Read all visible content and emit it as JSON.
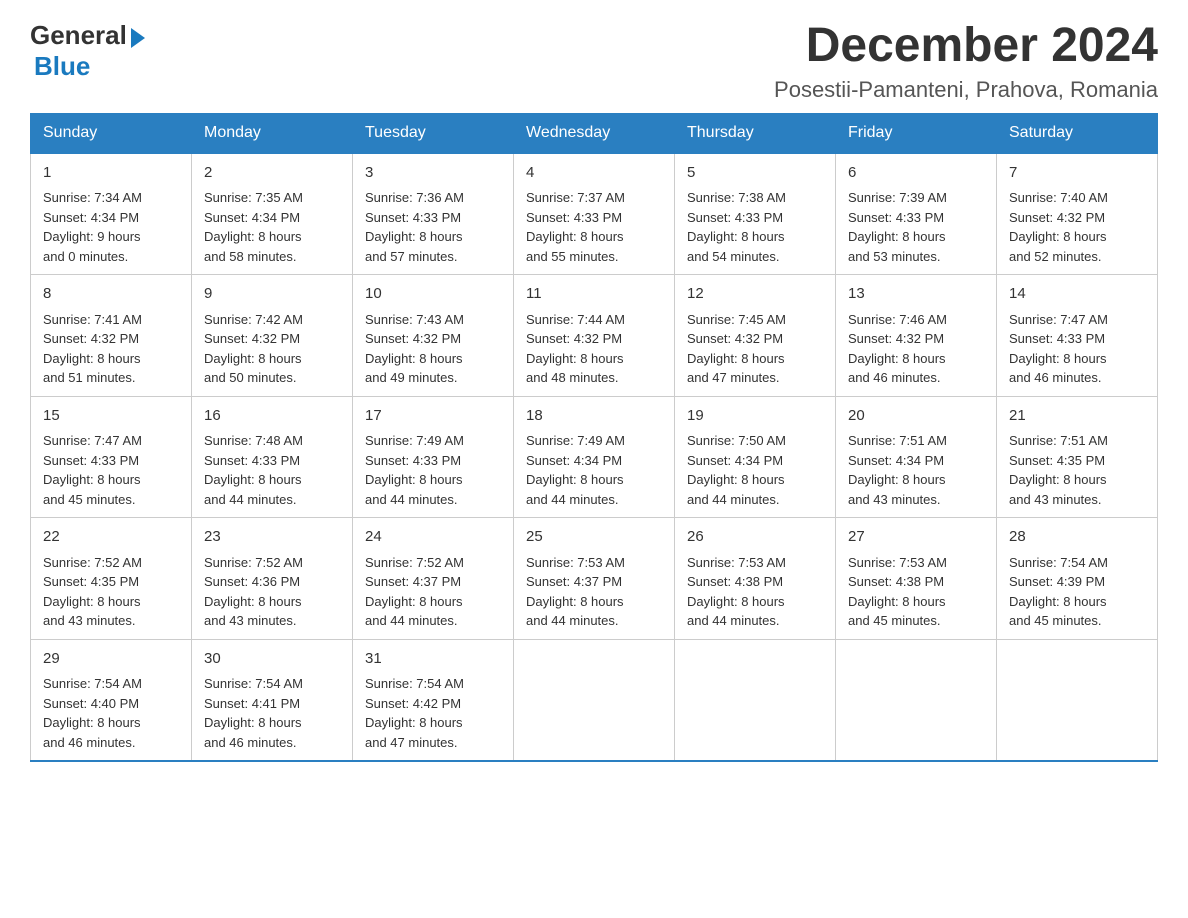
{
  "logo": {
    "general": "General",
    "blue": "Blue"
  },
  "title": "December 2024",
  "location": "Posestii-Pamanteni, Prahova, Romania",
  "days": [
    "Sunday",
    "Monday",
    "Tuesday",
    "Wednesday",
    "Thursday",
    "Friday",
    "Saturday"
  ],
  "weeks": [
    [
      {
        "day": "1",
        "sunrise": "7:34 AM",
        "sunset": "4:34 PM",
        "daylight": "9 hours and 0 minutes."
      },
      {
        "day": "2",
        "sunrise": "7:35 AM",
        "sunset": "4:34 PM",
        "daylight": "8 hours and 58 minutes."
      },
      {
        "day": "3",
        "sunrise": "7:36 AM",
        "sunset": "4:33 PM",
        "daylight": "8 hours and 57 minutes."
      },
      {
        "day": "4",
        "sunrise": "7:37 AM",
        "sunset": "4:33 PM",
        "daylight": "8 hours and 55 minutes."
      },
      {
        "day": "5",
        "sunrise": "7:38 AM",
        "sunset": "4:33 PM",
        "daylight": "8 hours and 54 minutes."
      },
      {
        "day": "6",
        "sunrise": "7:39 AM",
        "sunset": "4:33 PM",
        "daylight": "8 hours and 53 minutes."
      },
      {
        "day": "7",
        "sunrise": "7:40 AM",
        "sunset": "4:32 PM",
        "daylight": "8 hours and 52 minutes."
      }
    ],
    [
      {
        "day": "8",
        "sunrise": "7:41 AM",
        "sunset": "4:32 PM",
        "daylight": "8 hours and 51 minutes."
      },
      {
        "day": "9",
        "sunrise": "7:42 AM",
        "sunset": "4:32 PM",
        "daylight": "8 hours and 50 minutes."
      },
      {
        "day": "10",
        "sunrise": "7:43 AM",
        "sunset": "4:32 PM",
        "daylight": "8 hours and 49 minutes."
      },
      {
        "day": "11",
        "sunrise": "7:44 AM",
        "sunset": "4:32 PM",
        "daylight": "8 hours and 48 minutes."
      },
      {
        "day": "12",
        "sunrise": "7:45 AM",
        "sunset": "4:32 PM",
        "daylight": "8 hours and 47 minutes."
      },
      {
        "day": "13",
        "sunrise": "7:46 AM",
        "sunset": "4:32 PM",
        "daylight": "8 hours and 46 minutes."
      },
      {
        "day": "14",
        "sunrise": "7:47 AM",
        "sunset": "4:33 PM",
        "daylight": "8 hours and 46 minutes."
      }
    ],
    [
      {
        "day": "15",
        "sunrise": "7:47 AM",
        "sunset": "4:33 PM",
        "daylight": "8 hours and 45 minutes."
      },
      {
        "day": "16",
        "sunrise": "7:48 AM",
        "sunset": "4:33 PM",
        "daylight": "8 hours and 44 minutes."
      },
      {
        "day": "17",
        "sunrise": "7:49 AM",
        "sunset": "4:33 PM",
        "daylight": "8 hours and 44 minutes."
      },
      {
        "day": "18",
        "sunrise": "7:49 AM",
        "sunset": "4:34 PM",
        "daylight": "8 hours and 44 minutes."
      },
      {
        "day": "19",
        "sunrise": "7:50 AM",
        "sunset": "4:34 PM",
        "daylight": "8 hours and 44 minutes."
      },
      {
        "day": "20",
        "sunrise": "7:51 AM",
        "sunset": "4:34 PM",
        "daylight": "8 hours and 43 minutes."
      },
      {
        "day": "21",
        "sunrise": "7:51 AM",
        "sunset": "4:35 PM",
        "daylight": "8 hours and 43 minutes."
      }
    ],
    [
      {
        "day": "22",
        "sunrise": "7:52 AM",
        "sunset": "4:35 PM",
        "daylight": "8 hours and 43 minutes."
      },
      {
        "day": "23",
        "sunrise": "7:52 AM",
        "sunset": "4:36 PM",
        "daylight": "8 hours and 43 minutes."
      },
      {
        "day": "24",
        "sunrise": "7:52 AM",
        "sunset": "4:37 PM",
        "daylight": "8 hours and 44 minutes."
      },
      {
        "day": "25",
        "sunrise": "7:53 AM",
        "sunset": "4:37 PM",
        "daylight": "8 hours and 44 minutes."
      },
      {
        "day": "26",
        "sunrise": "7:53 AM",
        "sunset": "4:38 PM",
        "daylight": "8 hours and 44 minutes."
      },
      {
        "day": "27",
        "sunrise": "7:53 AM",
        "sunset": "4:38 PM",
        "daylight": "8 hours and 45 minutes."
      },
      {
        "day": "28",
        "sunrise": "7:54 AM",
        "sunset": "4:39 PM",
        "daylight": "8 hours and 45 minutes."
      }
    ],
    [
      {
        "day": "29",
        "sunrise": "7:54 AM",
        "sunset": "4:40 PM",
        "daylight": "8 hours and 46 minutes."
      },
      {
        "day": "30",
        "sunrise": "7:54 AM",
        "sunset": "4:41 PM",
        "daylight": "8 hours and 46 minutes."
      },
      {
        "day": "31",
        "sunrise": "7:54 AM",
        "sunset": "4:42 PM",
        "daylight": "8 hours and 47 minutes."
      },
      null,
      null,
      null,
      null
    ]
  ]
}
